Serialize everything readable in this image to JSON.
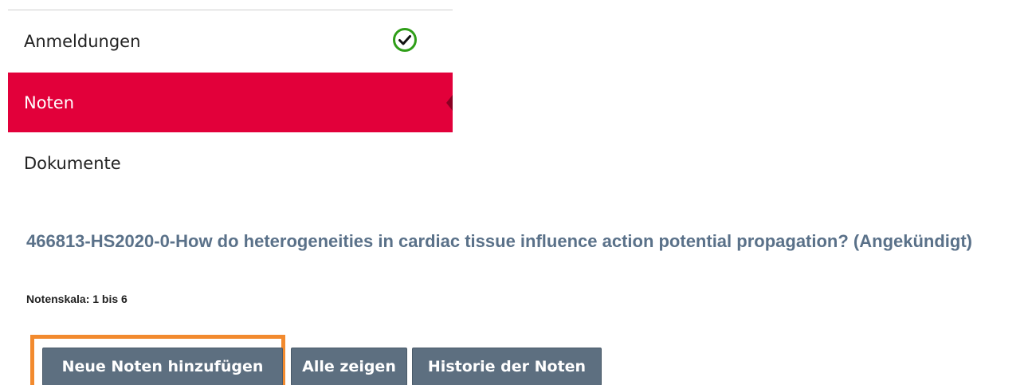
{
  "nav": {
    "items": [
      {
        "label": "Anmeldungen",
        "icon": "check-circle-icon"
      },
      {
        "label": "Noten",
        "active": true
      },
      {
        "label": "Dokumente"
      }
    ],
    "active_color": "#e2003a",
    "check_color": "#2f9e18"
  },
  "course": {
    "title": "466813-HS2020-0-How do heterogeneities in cardiac tissue influence action potential propagation? (Angekündigt)",
    "title_color": "#5a7189"
  },
  "grading": {
    "scale": "Notenskala: 1 bis 6"
  },
  "actions": {
    "add_grades": "Neue Noten hinzufügen",
    "show_all": "Alle zeigen",
    "grade_history": "Historie der Noten",
    "button_color": "#5d6f80",
    "highlight_color": "#f28a2e"
  }
}
